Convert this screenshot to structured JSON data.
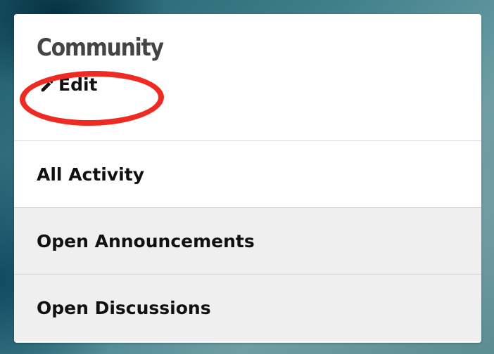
{
  "panel": {
    "title": "Community",
    "edit_label": "Edit"
  },
  "nav": {
    "items": [
      {
        "label": "All Activity",
        "state": "active"
      },
      {
        "label": "Open Announcements",
        "state": "inactive"
      },
      {
        "label": "Open Discussions",
        "state": "inactive"
      }
    ]
  },
  "colors": {
    "highlight": "#ee2a22",
    "active_bg": "#ffffff",
    "inactive_bg": "#efefef",
    "title": "#444444"
  },
  "icons": {
    "edit": "pencil-icon"
  }
}
